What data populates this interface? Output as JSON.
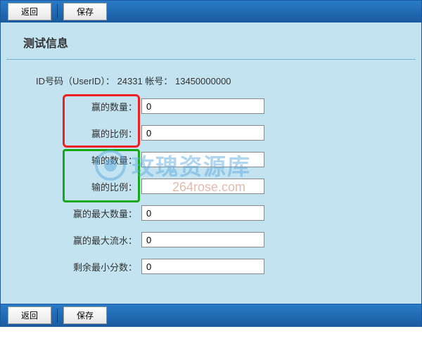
{
  "toolbar": {
    "back_label": "返回",
    "save_label": "保存"
  },
  "section_title": "测试信息",
  "info": {
    "id_label": "ID号码（UserID）：",
    "id_value": "24331",
    "account_label": "帐号：",
    "account_value": "13450000000"
  },
  "form": {
    "win_count": {
      "label": "赢的数量：",
      "value": "0"
    },
    "win_ratio": {
      "label": "赢的比例：",
      "value": "0"
    },
    "lose_count": {
      "label": "输的数量：",
      "value": ""
    },
    "lose_ratio": {
      "label": "输的比例：",
      "value": ""
    },
    "win_max_count": {
      "label": "赢的最大数量：",
      "value": "0"
    },
    "win_max_flow": {
      "label": "赢的最大流水：",
      "value": "0"
    },
    "remain_min_score": {
      "label": "剩余最小分数：",
      "value": "0"
    }
  },
  "watermark": {
    "main": "玫瑰资源库",
    "sub": "264rose.com"
  }
}
